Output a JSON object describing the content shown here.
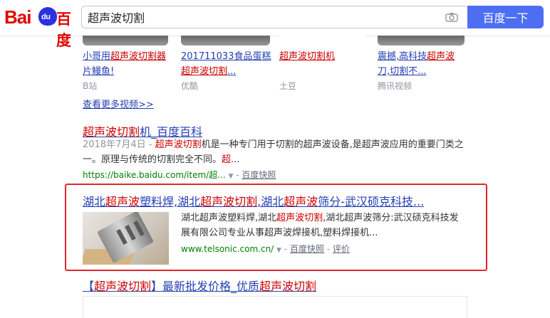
{
  "header": {
    "logo_text_left": "Bai",
    "logo_paw_text": "du",
    "logo_text_right": "百度",
    "search_value": "超声波切割",
    "search_button": "百度一下"
  },
  "videos": [
    {
      "title_parts": [
        "小哥用",
        "超声波切割器",
        "片鳗鱼!"
      ],
      "source": "B站"
    },
    {
      "title_parts": [
        "201711033食品蛋糕",
        "超声波切割",
        "..."
      ],
      "source": "优酷"
    },
    {
      "title_parts": [
        "超声波切割机"
      ],
      "source": "土豆"
    },
    {
      "title_parts": [
        "震撼,高科技",
        "超声波",
        "刀,切割不..."
      ],
      "source": "腾讯视频"
    }
  ],
  "more_videos": "查看更多视频>>",
  "result1": {
    "title_hl": "超声波切割",
    "title_rest": "机_百度百科",
    "date": "2018年7月4日 -",
    "snippet_hl1": "超声波切割",
    "snippet_rest": "机是一种专门用于切割的超声波设备,是超声波应用的重要门类之一。原理与传统的切割完全不同。",
    "snippet_hl2": "超",
    "snippet_tail": "...",
    "url": "https://baike.baidu.com/item/超...",
    "cache": "百度快照"
  },
  "result2": {
    "title_p1": "湖北",
    "title_p2": "超声波",
    "title_p3": "塑料焊,湖北",
    "title_p4": "超声波切割",
    "title_p5": ",湖北",
    "title_p6": "超声波",
    "title_p7": "筛分-武汉硕克科技...",
    "snippet_p1": "湖北超声波塑料焊,湖北",
    "snippet_hl": "超声波切割",
    "snippet_p2": ",湖北超声波筛分:武汉硕克科技发展有限公司专业从事超声波焊接机,塑料焊接机...",
    "url": "www.telsonic.com.cn/",
    "cache": "百度快照",
    "review": "评价"
  },
  "result3": {
    "title_p1": "【",
    "title_hl1": "超声波切割",
    "title_p2": "】最新批发价格_优质",
    "title_hl2": "超声波切割"
  }
}
